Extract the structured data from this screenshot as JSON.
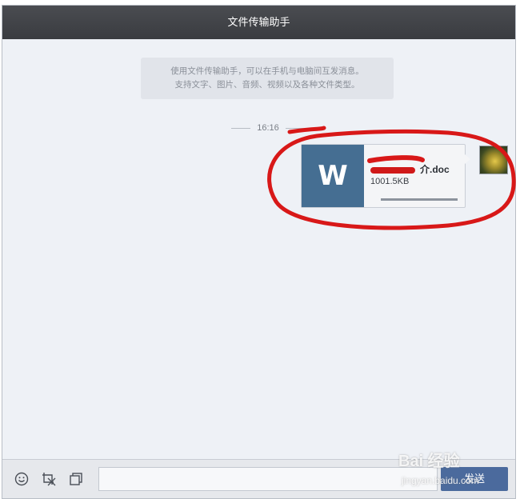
{
  "window": {
    "title": "文件传输助手"
  },
  "chat": {
    "hint_line1": "使用文件传输助手，可以在手机与电脑间互发消息。",
    "hint_line2": "支持文字、图片、音频、视频以及各种文件类型。",
    "time": "16:16",
    "message": {
      "file_icon_letter": "W",
      "file_name_visible": "介.doc",
      "file_size": "1001.5KB",
      "progress_fraction": 1.0,
      "file_icon_color": "#456e92"
    }
  },
  "bottom": {
    "send_label": "发送",
    "icons": [
      "emoji-icon",
      "screenshot-icon",
      "window-icon"
    ]
  },
  "watermark": {
    "text": "Bai 经验",
    "url": "jingyan.baidu.com"
  },
  "colors": {
    "titlebar": "#3f4145",
    "chat_bg": "#eef1f6",
    "send_button": "#4b6a9d",
    "annotation": "#d81818"
  }
}
